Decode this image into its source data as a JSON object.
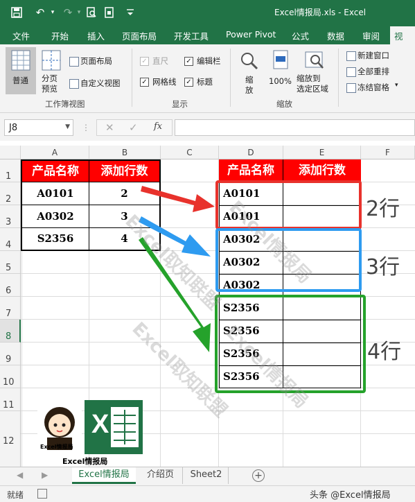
{
  "window": {
    "title": "Excel情报局.xls - Excel"
  },
  "ribbon_tabs": [
    "文件",
    "开始",
    "插入",
    "页面布局",
    "开发工具",
    "Power Pivot",
    "公式",
    "数据",
    "审阅",
    "视图"
  ],
  "ribbon": {
    "workbook_views": {
      "normal": "普通",
      "page_break": "分页\n预览",
      "page_layout": "页面布局",
      "custom_views": "自定义视图",
      "group_label": "工作簿视图"
    },
    "show": {
      "ruler": "直尺",
      "formula_bar": "编辑栏",
      "gridlines": "网格线",
      "headings": "标题",
      "group_label": "显示"
    },
    "zoom": {
      "zoom": "缩\n放",
      "hundred": "100%",
      "zoom_to_selection": "缩放到\n选定区域",
      "group_label": "缩放"
    },
    "window": {
      "new_window": "新建窗口",
      "arrange_all": "全部重排",
      "freeze_panes": "冻结窗格"
    }
  },
  "formula_bar": {
    "name_box": "J8",
    "fx": "fx",
    "value": ""
  },
  "sheet": {
    "columns": [
      "A",
      "B",
      "C",
      "D",
      "E",
      "F"
    ],
    "rows": [
      "1",
      "2",
      "3",
      "4",
      "5",
      "6",
      "7",
      "8",
      "9",
      "10",
      "11",
      "12"
    ],
    "source_table": {
      "headers": [
        "产品名称",
        "添加行数"
      ],
      "rows": [
        [
          "A0101",
          "2"
        ],
        [
          "A0302",
          "3"
        ],
        [
          "S2356",
          "4"
        ]
      ]
    },
    "result_table": {
      "headers": [
        "产品名称",
        "添加行数"
      ],
      "rows": [
        "A0101",
        "A0101",
        "A0302",
        "A0302",
        "A0302",
        "S2356",
        "S2356",
        "S2356",
        "S2356"
      ]
    },
    "group_labels": [
      "2行",
      "3行",
      "4行"
    ],
    "watermarks": [
      "Excel取知联盟",
      "Excel情报局"
    ],
    "logo": {
      "caption": "Excel情报局",
      "badge_text": "Excel情报局",
      "x_letter": "X"
    },
    "colors": {
      "header_fill": "#ff0000",
      "box_red": "#e8322c",
      "box_blue": "#2e9bf0",
      "box_green": "#25a22b",
      "excel_green": "#217346"
    }
  },
  "sheet_tabs": [
    "Excel情报局",
    "介绍页",
    "Sheet2"
  ],
  "status": {
    "ready": "就绪"
  },
  "footer_watermark": "头条 @Excel情报局"
}
